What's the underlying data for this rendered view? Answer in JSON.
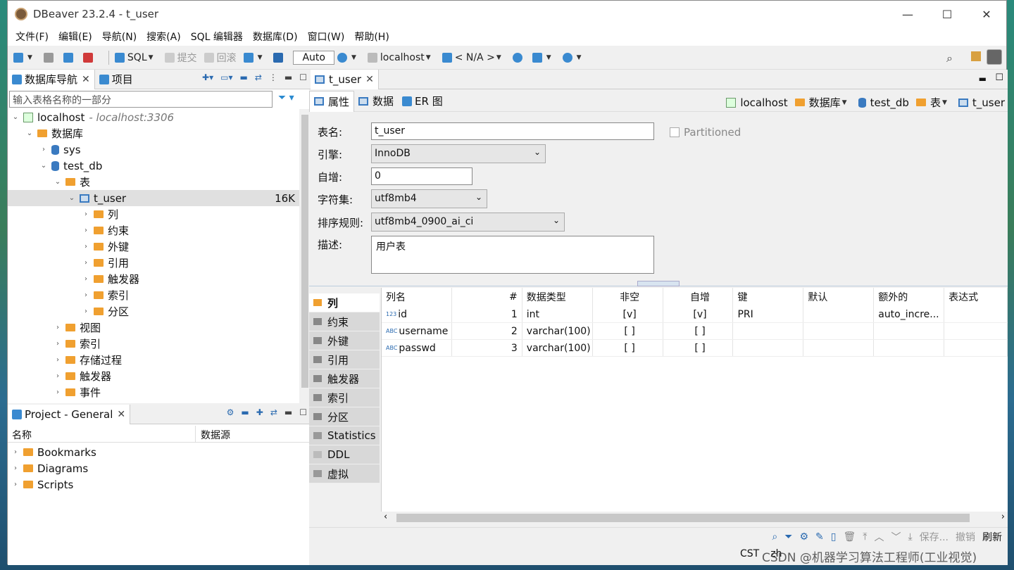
{
  "window": {
    "title": "DBeaver 23.2.4 - t_user"
  },
  "menu": [
    "文件(F)",
    "编辑(E)",
    "导航(N)",
    "搜索(A)",
    "SQL 编辑器",
    "数据库(D)",
    "窗口(W)",
    "帮助(H)"
  ],
  "toolbar": {
    "sql": "SQL",
    "commit": "提交",
    "rollback": "回滚",
    "auto": "Auto",
    "conn": "localhost",
    "schema": "< N/A >"
  },
  "nav": {
    "tab1": "数据库导航",
    "tab2": "项目",
    "filter_placeholder": "输入表格名称的一部分"
  },
  "tree": {
    "host": "localhost",
    "host_addr": "- localhost:3306",
    "databases": "数据库",
    "sys": "sys",
    "test_db": "test_db",
    "tables": "表",
    "t_user": "t_user",
    "t_user_size": "16K",
    "children": [
      "列",
      "约束",
      "外键",
      "引用",
      "触发器",
      "索引",
      "分区"
    ],
    "views": "视图",
    "indexes": "索引",
    "procs": "存储过程",
    "triggers": "触发器",
    "events": "事件"
  },
  "project": {
    "tab": "Project - General",
    "col_name": "名称",
    "col_source": "数据源",
    "items": [
      "Bookmarks",
      "Diagrams",
      "Scripts"
    ]
  },
  "editor": {
    "tab": "t_user",
    "subtabs": [
      "属性",
      "数据",
      "ER 图"
    ],
    "crumb": {
      "host": "localhost",
      "db": "数据库",
      "schema": "test_db",
      "tables": "表",
      "table": "t_user"
    },
    "labels": {
      "name": "表名:",
      "engine": "引擎:",
      "auto": "自增:",
      "charset": "字符集:",
      "collation": "排序规则:",
      "desc": "描述:"
    },
    "values": {
      "name": "t_user",
      "engine": "InnoDB",
      "auto": "0",
      "charset": "utf8mb4",
      "collation": "utf8mb4_0900_ai_ci",
      "desc": "用户表"
    },
    "partitioned": "Partitioned",
    "side": [
      "列",
      "约束",
      "外键",
      "引用",
      "触发器",
      "索引",
      "分区",
      "Statistics",
      "DDL",
      "虚拟"
    ],
    "columns": [
      "列名",
      "#",
      "数据类型",
      "非空",
      "自增",
      "键",
      "默认",
      "额外的",
      "表达式"
    ],
    "rows": [
      {
        "name": "id",
        "num": "1",
        "type": "int",
        "nn": "[v]",
        "ai": "[v]",
        "key": "PRI",
        "def": "",
        "extra": "auto_incre...",
        "expr": ""
      },
      {
        "name": "username",
        "num": "2",
        "type": "varchar(100)",
        "nn": "[ ]",
        "ai": "[ ]",
        "key": "",
        "def": "",
        "extra": "",
        "expr": ""
      },
      {
        "name": "passwd",
        "num": "3",
        "type": "varchar(100)",
        "nn": "[ ]",
        "ai": "[ ]",
        "key": "",
        "def": "",
        "extra": "",
        "expr": ""
      }
    ],
    "bottom": {
      "save": "保存...",
      "undo": "撤销",
      "refresh": "刷新"
    }
  },
  "status": {
    "tz": "CST",
    "lang": "zh"
  },
  "watermark": "CSDN @机器学习算法工程师(工业视觉)"
}
